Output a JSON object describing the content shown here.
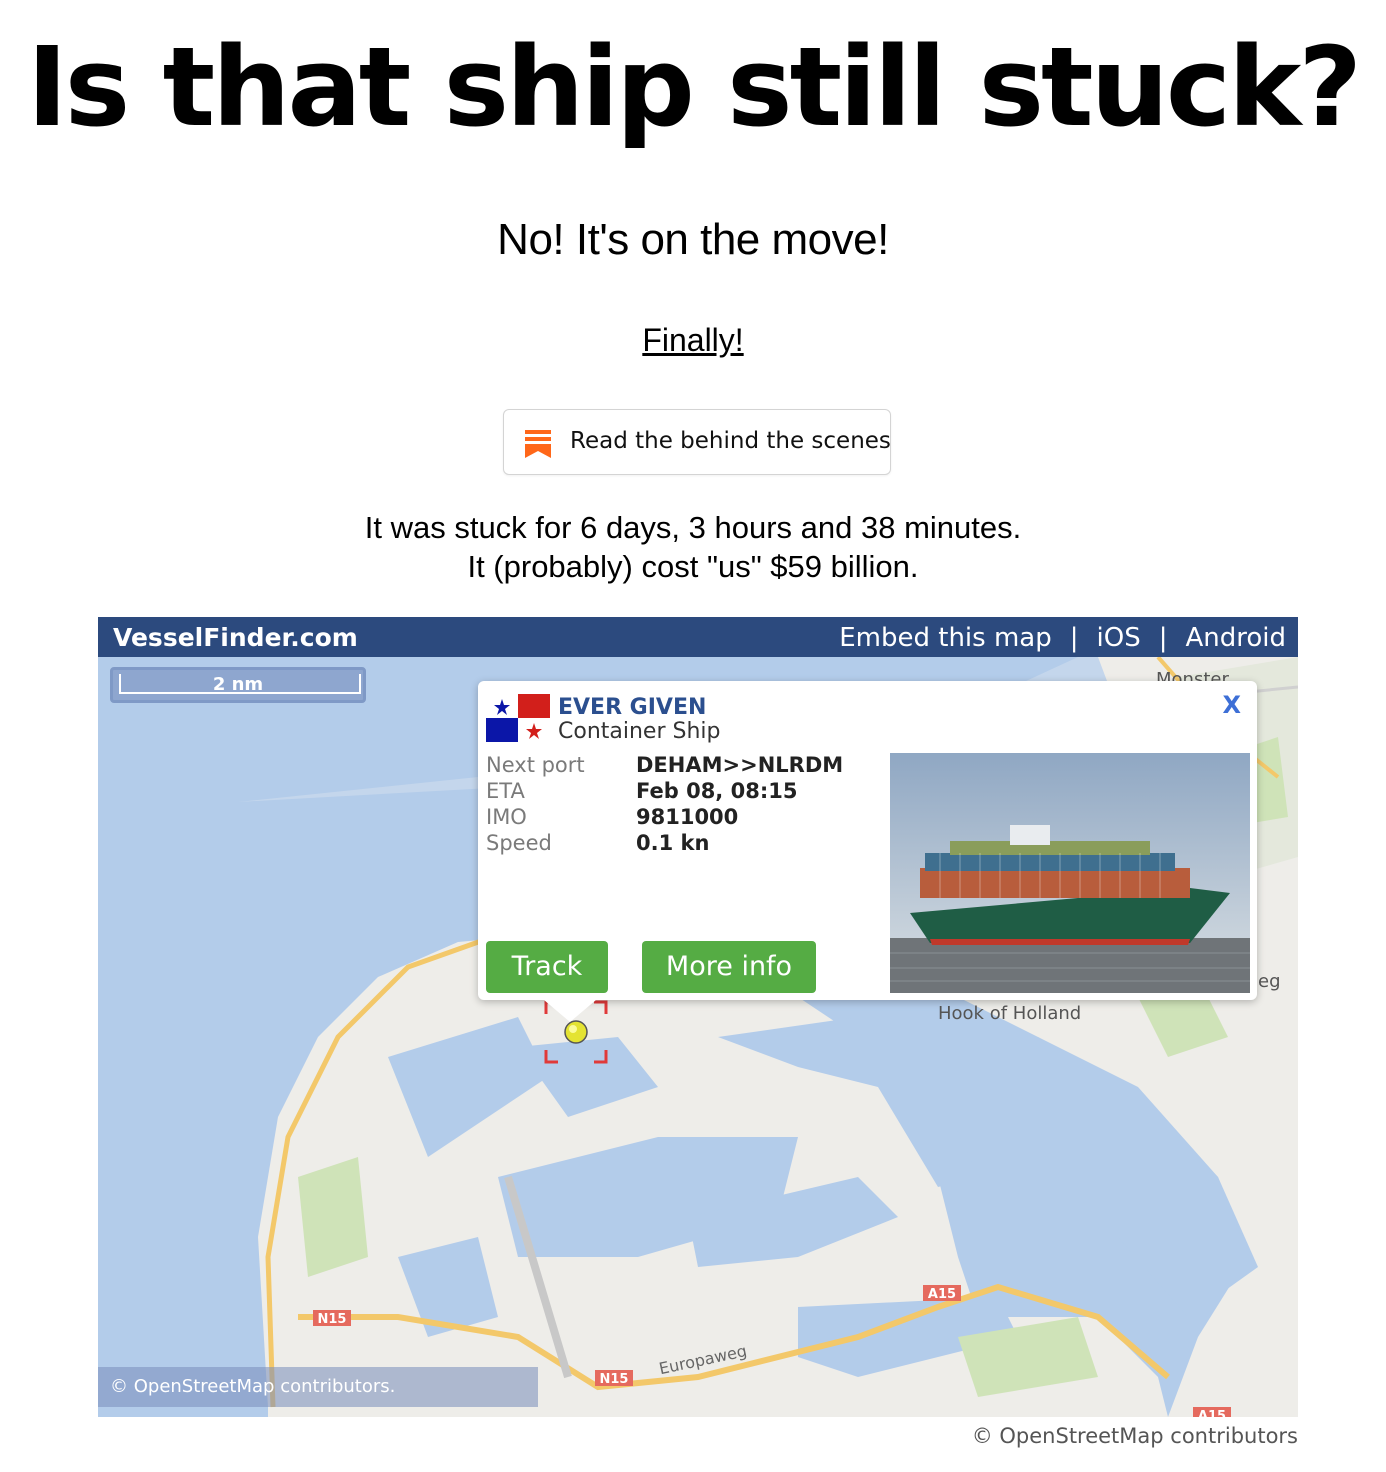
{
  "page": {
    "title": "Is that ship still stuck?",
    "subtitle": "No! It's on the move!",
    "finally_link": "Finally!",
    "behind_scenes_button": "Read the behind the scenes",
    "stuck_duration": "It was stuck for 6 days, 3 hours and 38 minutes.",
    "cost": "It (probably) cost \"us\" $59 billion.",
    "attribution_below": "© OpenStreetMap contributors"
  },
  "map": {
    "brand": "VesselFinder.com",
    "links": [
      "Embed this map",
      "iOS",
      "Android"
    ],
    "link_separator": "|",
    "scale_label": "2 nm",
    "attribution": "© OpenStreetMap contributors.",
    "place_labels": [
      "Hook of Holland",
      "Monster",
      "Europaweg",
      "eg"
    ],
    "road_shields": [
      "N15",
      "N15",
      "A15",
      "A15"
    ],
    "colors": {
      "water": "#b3ccea",
      "land": "#eeede9",
      "green": "#cfe3b8",
      "road": "#f3c86a",
      "bar": "#2c4a7e"
    }
  },
  "popup": {
    "flag": "panama-flag-icon",
    "name": "EVER GIVEN",
    "type": "Container Ship",
    "close": "X",
    "details": [
      {
        "label": "Next port",
        "value": "DEHAM>>NLRDM"
      },
      {
        "label": "ETA",
        "value": "Feb 08, 08:15"
      },
      {
        "label": "IMO",
        "value": "9811000"
      },
      {
        "label": "Speed",
        "value": "0.1 kn"
      }
    ],
    "track_button": "Track",
    "more_info_button": "More info",
    "button_color": "#55ac44"
  }
}
